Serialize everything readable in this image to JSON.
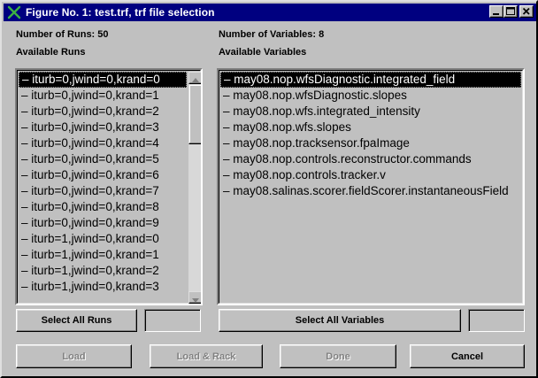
{
  "window": {
    "title": "Figure No. 1: test.trf, trf file selection",
    "icon": "matlab-x-icon",
    "controls": [
      "minimize-icon",
      "maximize-icon",
      "close-icon"
    ]
  },
  "runs": {
    "count_label": "Number of Runs: 50",
    "heading": "Available Runs",
    "items": [
      "iturb=0,jwind=0,krand=0",
      "iturb=0,jwind=0,krand=1",
      "iturb=0,jwind=0,krand=2",
      "iturb=0,jwind=0,krand=3",
      "iturb=0,jwind=0,krand=4",
      "iturb=0,jwind=0,krand=5",
      "iturb=0,jwind=0,krand=6",
      "iturb=0,jwind=0,krand=7",
      "iturb=0,jwind=0,krand=8",
      "iturb=0,jwind=0,krand=9",
      "iturb=1,jwind=0,krand=0",
      "iturb=1,jwind=0,krand=1",
      "iturb=1,jwind=0,krand=2",
      "iturb=1,jwind=0,krand=3"
    ],
    "selected_index": 0,
    "select_all_label": "Select All Runs",
    "field_value": ""
  },
  "variables": {
    "count_label": "Number of Variables: 8",
    "heading": "Available Variables",
    "items": [
      "may08.nop.wfsDiagnostic.integrated_field",
      "may08.nop.wfsDiagnostic.slopes",
      "may08.nop.wfs.integrated_intensity",
      "may08.nop.wfs.slopes",
      "may08.nop.tracksensor.fpaImage",
      "may08.nop.controls.reconstructor.commands",
      "may08.nop.controls.tracker.v",
      "may08.salinas.scorer.fieldScorer.instantaneousField"
    ],
    "selected_index": 0,
    "select_all_label": "Select All Variables",
    "field_value": ""
  },
  "actions": {
    "load_label": "Load",
    "load_rack_label": "Load & Rack",
    "done_label": "Done",
    "cancel_label": "Cancel"
  },
  "colors": {
    "titlebar": "#000080",
    "face": "#c0c0c0",
    "selection": "#000000"
  }
}
